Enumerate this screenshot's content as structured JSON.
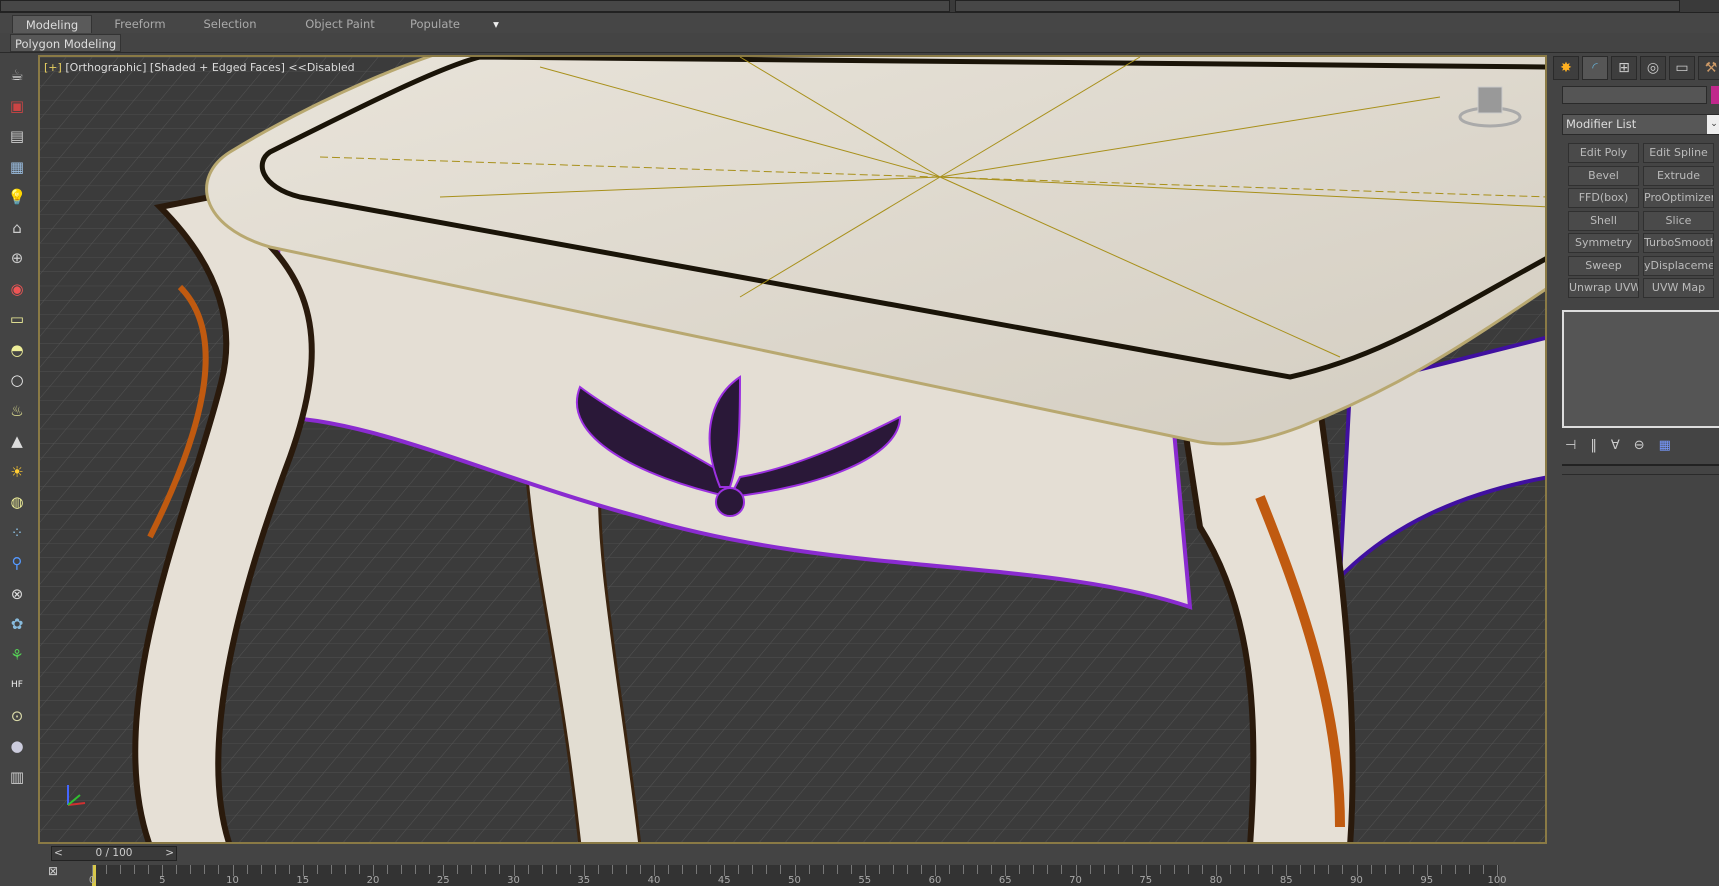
{
  "ribbon": {
    "tabs": [
      "Modeling",
      "Freeform",
      "Selection",
      "Object Paint",
      "Populate"
    ],
    "active_tab": "Modeling",
    "subtab": "Polygon Modeling"
  },
  "left_toolbar": {
    "icons": [
      "teapot-icon",
      "render-frame-icon",
      "render-setup-icon",
      "material-editor-icon",
      "light-icon",
      "camera-icon",
      "helper-icon",
      "video-camera-icon",
      "box-icon",
      "sphere-half-icon",
      "sphere-icon",
      "teapot-basket-icon",
      "cone-icon",
      "sun-icon",
      "torus-icon",
      "particle-icon",
      "bone-icon",
      "geosphere-icon",
      "gear-icon",
      "grass-icon",
      "hair-icon",
      "spray-icon",
      "material-ball-icon",
      "document-icon"
    ]
  },
  "viewport": {
    "label_plus": "[+]",
    "label_view": "[Orthographic]",
    "label_shading": "[Shaded + Edged Faces]",
    "label_extra": "<<Disabled"
  },
  "command_panel": {
    "tabs": [
      "create-icon",
      "modify-icon",
      "hierarchy-icon",
      "motion-icon",
      "display-icon",
      "utilities-icon"
    ],
    "active_tab": "modify-icon",
    "object_color": "#c0288c",
    "modifier_list": "Modifier List",
    "modifier_buttons": [
      "Edit Poly",
      "Edit Spline",
      "Bevel",
      "Extrude",
      "FFD(box)",
      "ProOptimizer",
      "Shell",
      "Slice",
      "Symmetry",
      "TurboSmooth",
      "Sweep",
      "yDisplacement",
      "Unwrap UVW",
      "UVW Map"
    ],
    "stack_icons": [
      "pin-stack-icon",
      "show-end-result-icon",
      "make-unique-icon",
      "remove-modifier-icon",
      "configure-sets-icon"
    ]
  },
  "timeline": {
    "frame_display": "0 / 100",
    "prev": "<",
    "next": ">",
    "labels": [
      "0",
      "5",
      "10",
      "15",
      "20",
      "25",
      "30",
      "35",
      "40",
      "45",
      "50",
      "55",
      "60",
      "65",
      "70",
      "75",
      "80",
      "85",
      "90",
      "95",
      "100"
    ]
  }
}
